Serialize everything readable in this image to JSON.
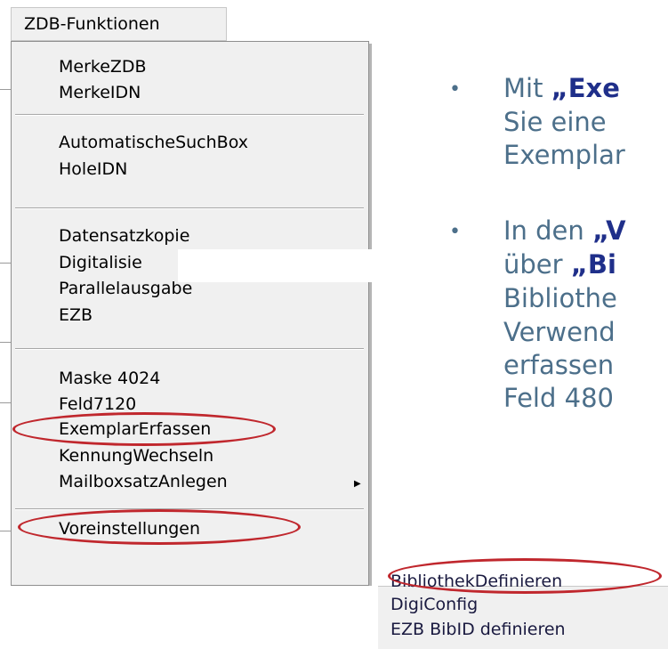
{
  "menu": {
    "title": "ZDB-Funktionen",
    "groups": [
      [
        "MerkeZDB",
        "MerkeIDN"
      ],
      [
        "AutomatischeSuchBox",
        "HoleIDN"
      ],
      [
        "Datensatzkopie",
        "Digitalisie",
        "Parallelausgabe",
        "EZB"
      ],
      [
        "Maske 4024",
        "Feld7120",
        "ExemplarErfassen",
        "KennungWechseln",
        "MailboxsatzAnlegen"
      ],
      [
        "Voreinstellungen"
      ]
    ]
  },
  "submenu": {
    "items": [
      "BibliothekDefinieren",
      "DigiConfig",
      "EZB BibID definieren"
    ]
  },
  "slide": {
    "b1_line1_pre": "Mit ",
    "b1_line1_bold": "„Exe",
    "b1_line2": "Sie eine",
    "b1_line3": "Exemplar",
    "b2_line1_pre": "In den ",
    "b2_line1_mid": "„V",
    "b2_line2_pre": "über ",
    "b2_line2_bold": "„Bi",
    "b2_line3": "Bibliothe",
    "b2_line4": "Verwend",
    "b2_line5": "erfassen",
    "b2_line6": "Feld 480",
    "bullet_char": "•"
  },
  "colors": {
    "highlight": "#c0272d",
    "slide_text": "#4c6f8a",
    "slide_bold": "#1f2f8a"
  }
}
